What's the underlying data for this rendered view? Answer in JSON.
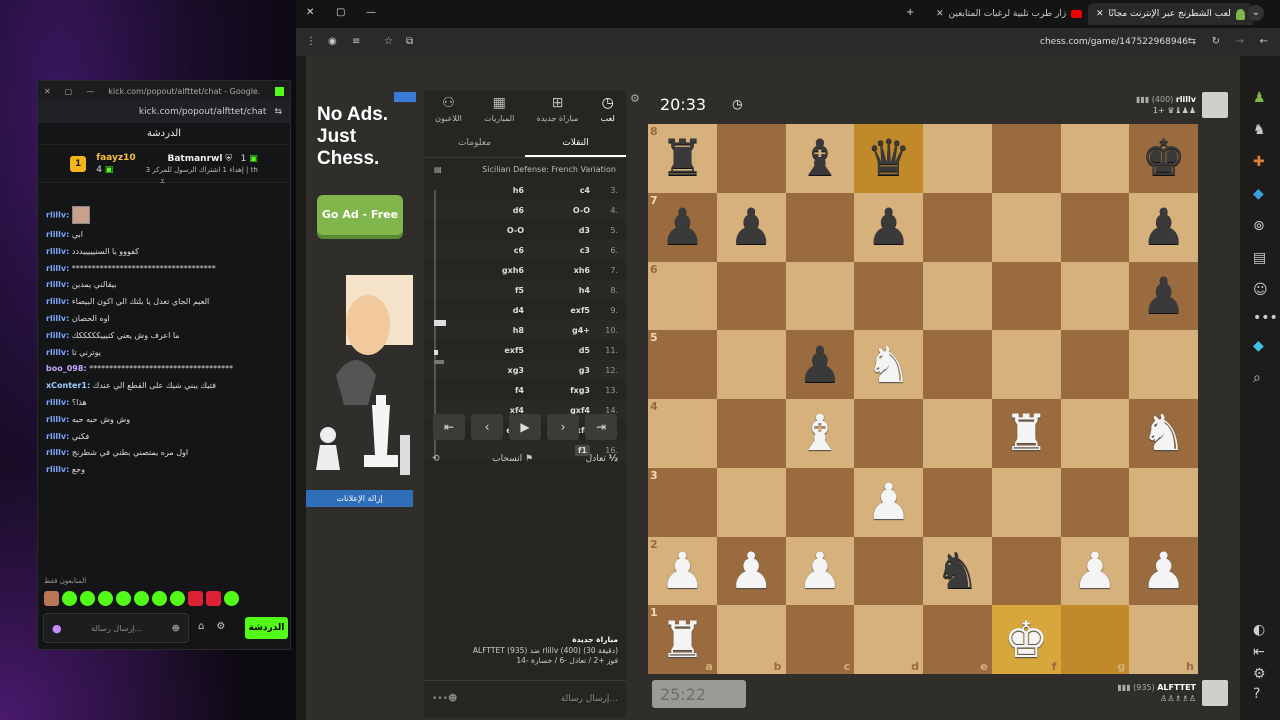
{
  "chat": {
    "window_title": "kick.com/popout/alfttet/chat - Google...",
    "url": "kick.com/popout/alfttet/chat",
    "header": "الدردشة",
    "gifters": [
      {
        "rank": "1",
        "name": "faayz10",
        "count": "4"
      },
      {
        "name": "Batmanrwl",
        "count": "1",
        "note": "إهداء 1 اشتراك الرسول للمركز 3 | th"
      }
    ],
    "messages": [
      {
        "user": "rlillv:",
        "text": "",
        "avatar": true
      },
      {
        "user": "rlillv:",
        "text": "ابي"
      },
      {
        "user": "rlillv:",
        "text": "كفووو يا السنيييييددد"
      },
      {
        "user": "rlillv:",
        "text": "************************************"
      },
      {
        "user": "rlillv:",
        "text": "بيقالني يمدين"
      },
      {
        "user": "rlillv:",
        "text": "العيم الجاي تعدل يا بلتك الي اكون البيصاء"
      },
      {
        "user": "rlillv:",
        "text": "اوه الحصان"
      },
      {
        "user": "rlillv:",
        "text": "ما اعرف وش يعني كتيييكككككك"
      },
      {
        "user": "rlillv:",
        "text": "يوترني تا"
      },
      {
        "user": "boo_098:",
        "text": "************************************"
      },
      {
        "user": "xConter1:",
        "text": "فتيك يبني شيك على القطع الي عندك"
      },
      {
        "user": "rlillv:",
        "text": "هذا؟"
      },
      {
        "user": "rlillv:",
        "text": "وش وش حبه حبه"
      },
      {
        "user": "rlillv:",
        "text": "فكني"
      },
      {
        "user": "rlillv:",
        "text": "اول مره يمتصني بطني في شطرنج"
      },
      {
        "user": "rlillv:",
        "text": "وجع"
      }
    ],
    "emotes_label": "المتابعون فقط",
    "input_placeholder": "إرسال رسالة...",
    "send_label": "الدردشة"
  },
  "browser": {
    "tabs": [
      {
        "label": "لعب الشطرنج عبر الإنترنت مجانًا",
        "active": true
      },
      {
        "label": "زار طرب تلبية لرغبات المتابعين",
        "active": false
      }
    ],
    "url": "chess.com/game/147522968946"
  },
  "ad": {
    "title": "No Ads. Just Chess.",
    "button": "Go Ad - Free",
    "remove": "إزالة الإعلانات"
  },
  "panel": {
    "tabs": [
      {
        "label": "لعب",
        "icon": "clock-icon"
      },
      {
        "label": "مباراة جديدة",
        "icon": "plus-icon"
      },
      {
        "label": "المباريات",
        "icon": "board-icon"
      },
      {
        "label": "اللاعبون",
        "icon": "players-icon"
      }
    ],
    "subtabs": [
      {
        "label": "النقلات",
        "active": true
      },
      {
        "label": "معلومات",
        "active": false
      }
    ],
    "opening": "Sicilian Defense: French Variation",
    "moves": [
      {
        "n": "3.",
        "w": "c4",
        "b": "h6"
      },
      {
        "n": "4.",
        "w": "O-O",
        "b": "d6"
      },
      {
        "n": "5.",
        "w": "d3",
        "b": "O-O"
      },
      {
        "n": "6.",
        "w": "c3",
        "b": "c6"
      },
      {
        "n": "7.",
        "w": "xh6",
        "b": "gxh6"
      },
      {
        "n": "8.",
        "w": "h4",
        "b": "f5"
      },
      {
        "n": "9.",
        "w": "exf5",
        "b": "d4"
      },
      {
        "n": "10.",
        "w": "g4+",
        "b": "h8"
      },
      {
        "n": "11.",
        "w": "d5",
        "b": "exf5"
      },
      {
        "n": "12.",
        "w": "g3",
        "b": "xg3"
      },
      {
        "n": "13.",
        "w": "fxg3",
        "b": "f4"
      },
      {
        "n": "14.",
        "w": "gxf4",
        "b": "xf4"
      },
      {
        "n": "15.",
        "w": "xf4",
        "b": "e2+"
      },
      {
        "n": "16.",
        "w": "f1",
        "b": ""
      }
    ],
    "nav": [
      "⇤",
      "‹",
      "▶",
      "›",
      "⇥"
    ],
    "draw": "تعادل",
    "resign": "انسحاب",
    "draw_icon": "½",
    "game_title": "مباراة جديدة",
    "game_line1": "ALFTTET (935) ضد rlillv (400) (30 دقيقة)",
    "game_line2": "فوز +2 / تعادل -6 / خسارة -14",
    "chat_placeholder": "إرسال رسالة..."
  },
  "top_player": {
    "name": "rlillv",
    "rating": "(400)",
    "timer": "20:33",
    "captured": "1+"
  },
  "bottom_player": {
    "name": "ALFTTET",
    "rating": "(935)",
    "timer": "25:22"
  },
  "board": {
    "rows": [
      [
        "bR",
        "",
        "bB",
        "bQ",
        "",
        "",
        "",
        "bK"
      ],
      [
        "bP",
        "bP",
        "",
        "bP",
        "",
        "",
        "",
        "bP"
      ],
      [
        "",
        "",
        "",
        "",
        "",
        "",
        "",
        "bP"
      ],
      [
        "",
        "",
        "bP",
        "wN",
        "",
        "",
        "",
        ""
      ],
      [
        "",
        "",
        "wB",
        "",
        "",
        "wR",
        "",
        "wN"
      ],
      [
        "",
        "",
        "",
        "wP",
        "",
        "",
        "",
        ""
      ],
      [
        "wP",
        "wP",
        "wP",
        "",
        "bN",
        "",
        "wP",
        "wP"
      ],
      [
        "wR",
        "",
        "",
        "",
        "",
        "wK",
        "",
        ""
      ]
    ],
    "highlights": [
      "d8",
      "f1",
      "g1"
    ],
    "ranks": [
      "8",
      "7",
      "6",
      "5",
      "4",
      "3",
      "2",
      "1"
    ],
    "files": [
      "a",
      "b",
      "c",
      "d",
      "e",
      "f",
      "g",
      "h"
    ]
  },
  "colors": {
    "kick_green": "#53fc18",
    "chess_green": "#81b64c",
    "light_sq": "#d7b17b",
    "dark_sq": "#9a6b3f"
  }
}
